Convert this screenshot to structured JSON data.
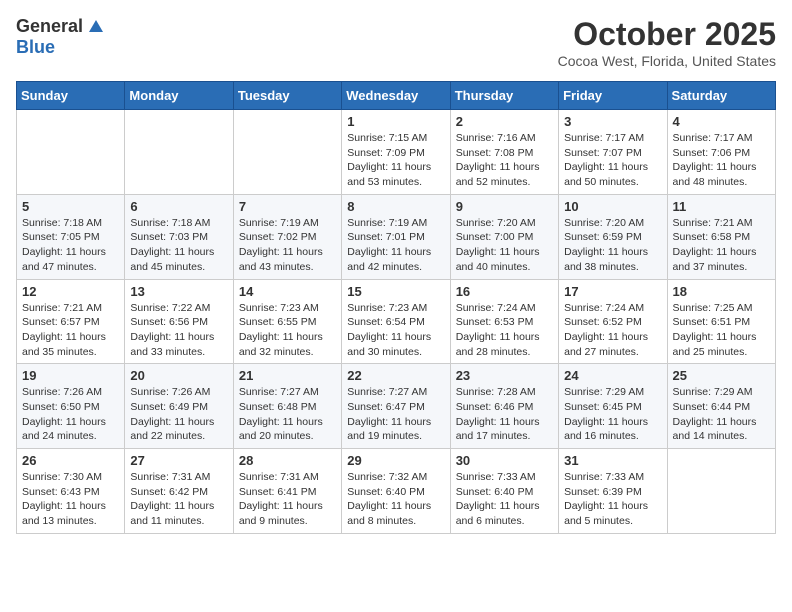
{
  "header": {
    "logo_general": "General",
    "logo_blue": "Blue",
    "month_title": "October 2025",
    "location": "Cocoa West, Florida, United States"
  },
  "weekdays": [
    "Sunday",
    "Monday",
    "Tuesday",
    "Wednesday",
    "Thursday",
    "Friday",
    "Saturday"
  ],
  "weeks": [
    [
      {
        "day": "",
        "info": ""
      },
      {
        "day": "",
        "info": ""
      },
      {
        "day": "",
        "info": ""
      },
      {
        "day": "1",
        "info": "Sunrise: 7:15 AM\nSunset: 7:09 PM\nDaylight: 11 hours\nand 53 minutes."
      },
      {
        "day": "2",
        "info": "Sunrise: 7:16 AM\nSunset: 7:08 PM\nDaylight: 11 hours\nand 52 minutes."
      },
      {
        "day": "3",
        "info": "Sunrise: 7:17 AM\nSunset: 7:07 PM\nDaylight: 11 hours\nand 50 minutes."
      },
      {
        "day": "4",
        "info": "Sunrise: 7:17 AM\nSunset: 7:06 PM\nDaylight: 11 hours\nand 48 minutes."
      }
    ],
    [
      {
        "day": "5",
        "info": "Sunrise: 7:18 AM\nSunset: 7:05 PM\nDaylight: 11 hours\nand 47 minutes."
      },
      {
        "day": "6",
        "info": "Sunrise: 7:18 AM\nSunset: 7:03 PM\nDaylight: 11 hours\nand 45 minutes."
      },
      {
        "day": "7",
        "info": "Sunrise: 7:19 AM\nSunset: 7:02 PM\nDaylight: 11 hours\nand 43 minutes."
      },
      {
        "day": "8",
        "info": "Sunrise: 7:19 AM\nSunset: 7:01 PM\nDaylight: 11 hours\nand 42 minutes."
      },
      {
        "day": "9",
        "info": "Sunrise: 7:20 AM\nSunset: 7:00 PM\nDaylight: 11 hours\nand 40 minutes."
      },
      {
        "day": "10",
        "info": "Sunrise: 7:20 AM\nSunset: 6:59 PM\nDaylight: 11 hours\nand 38 minutes."
      },
      {
        "day": "11",
        "info": "Sunrise: 7:21 AM\nSunset: 6:58 PM\nDaylight: 11 hours\nand 37 minutes."
      }
    ],
    [
      {
        "day": "12",
        "info": "Sunrise: 7:21 AM\nSunset: 6:57 PM\nDaylight: 11 hours\nand 35 minutes."
      },
      {
        "day": "13",
        "info": "Sunrise: 7:22 AM\nSunset: 6:56 PM\nDaylight: 11 hours\nand 33 minutes."
      },
      {
        "day": "14",
        "info": "Sunrise: 7:23 AM\nSunset: 6:55 PM\nDaylight: 11 hours\nand 32 minutes."
      },
      {
        "day": "15",
        "info": "Sunrise: 7:23 AM\nSunset: 6:54 PM\nDaylight: 11 hours\nand 30 minutes."
      },
      {
        "day": "16",
        "info": "Sunrise: 7:24 AM\nSunset: 6:53 PM\nDaylight: 11 hours\nand 28 minutes."
      },
      {
        "day": "17",
        "info": "Sunrise: 7:24 AM\nSunset: 6:52 PM\nDaylight: 11 hours\nand 27 minutes."
      },
      {
        "day": "18",
        "info": "Sunrise: 7:25 AM\nSunset: 6:51 PM\nDaylight: 11 hours\nand 25 minutes."
      }
    ],
    [
      {
        "day": "19",
        "info": "Sunrise: 7:26 AM\nSunset: 6:50 PM\nDaylight: 11 hours\nand 24 minutes."
      },
      {
        "day": "20",
        "info": "Sunrise: 7:26 AM\nSunset: 6:49 PM\nDaylight: 11 hours\nand 22 minutes."
      },
      {
        "day": "21",
        "info": "Sunrise: 7:27 AM\nSunset: 6:48 PM\nDaylight: 11 hours\nand 20 minutes."
      },
      {
        "day": "22",
        "info": "Sunrise: 7:27 AM\nSunset: 6:47 PM\nDaylight: 11 hours\nand 19 minutes."
      },
      {
        "day": "23",
        "info": "Sunrise: 7:28 AM\nSunset: 6:46 PM\nDaylight: 11 hours\nand 17 minutes."
      },
      {
        "day": "24",
        "info": "Sunrise: 7:29 AM\nSunset: 6:45 PM\nDaylight: 11 hours\nand 16 minutes."
      },
      {
        "day": "25",
        "info": "Sunrise: 7:29 AM\nSunset: 6:44 PM\nDaylight: 11 hours\nand 14 minutes."
      }
    ],
    [
      {
        "day": "26",
        "info": "Sunrise: 7:30 AM\nSunset: 6:43 PM\nDaylight: 11 hours\nand 13 minutes."
      },
      {
        "day": "27",
        "info": "Sunrise: 7:31 AM\nSunset: 6:42 PM\nDaylight: 11 hours\nand 11 minutes."
      },
      {
        "day": "28",
        "info": "Sunrise: 7:31 AM\nSunset: 6:41 PM\nDaylight: 11 hours\nand 9 minutes."
      },
      {
        "day": "29",
        "info": "Sunrise: 7:32 AM\nSunset: 6:40 PM\nDaylight: 11 hours\nand 8 minutes."
      },
      {
        "day": "30",
        "info": "Sunrise: 7:33 AM\nSunset: 6:40 PM\nDaylight: 11 hours\nand 6 minutes."
      },
      {
        "day": "31",
        "info": "Sunrise: 7:33 AM\nSunset: 6:39 PM\nDaylight: 11 hours\nand 5 minutes."
      },
      {
        "day": "",
        "info": ""
      }
    ]
  ]
}
